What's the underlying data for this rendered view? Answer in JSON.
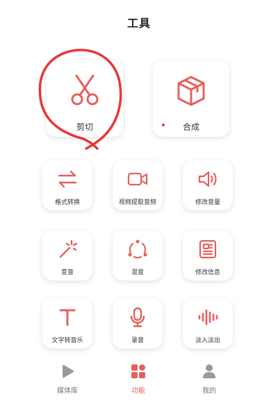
{
  "header": {
    "title": "工具"
  },
  "tools": {
    "cut": {
      "label": "剪切"
    },
    "merge": {
      "label": "合成"
    },
    "format": {
      "label": "格式转换"
    },
    "extract": {
      "label": "视频提取音频"
    },
    "volume": {
      "label": "修改音量"
    },
    "voice_change": {
      "label": "变音"
    },
    "mix": {
      "label": "混音"
    },
    "edit_info": {
      "label": "修改信息"
    },
    "tts": {
      "label": "文字转音乐"
    },
    "record": {
      "label": "录音"
    },
    "fade": {
      "label": "淡入淡出"
    }
  },
  "tabbar": {
    "items": [
      {
        "label": "媒体库",
        "icon": "play-icon"
      },
      {
        "label": "功能",
        "icon": "grid-icon",
        "active": true
      },
      {
        "label": "我的",
        "icon": "person-icon"
      }
    ]
  },
  "colors": {
    "accent": "#e4605e",
    "annotation": "#e8363a"
  }
}
